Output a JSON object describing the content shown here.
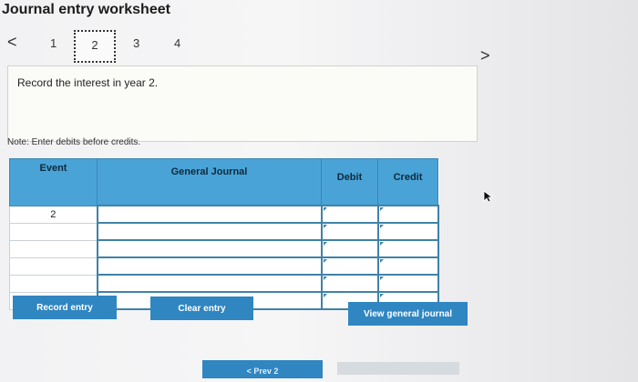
{
  "title": "Journal entry worksheet",
  "nav": {
    "prev": "<",
    "next": ">",
    "steps": [
      "1",
      "2",
      "3",
      "4"
    ],
    "active_step": "2"
  },
  "instruction": "Record the interest in year 2.",
  "note": "Note: Enter debits before credits.",
  "table": {
    "columns": [
      "Event",
      "General Journal",
      "Debit",
      "Credit"
    ],
    "rows": [
      {
        "event": "2",
        "account": "",
        "debit": "",
        "credit": ""
      },
      {
        "event": "",
        "account": "",
        "debit": "",
        "credit": ""
      },
      {
        "event": "",
        "account": "",
        "debit": "",
        "credit": ""
      },
      {
        "event": "",
        "account": "",
        "debit": "",
        "credit": ""
      },
      {
        "event": "",
        "account": "",
        "debit": "",
        "credit": ""
      },
      {
        "event": "",
        "account": "",
        "debit": "",
        "credit": ""
      }
    ]
  },
  "buttons": {
    "record": "Record entry",
    "clear": "Clear entry",
    "view": "View general journal",
    "prev_partial": "< Prev 2"
  },
  "colors": {
    "header_blue": "#4aa3d6",
    "button_blue": "#2f86c1"
  },
  "icons": {
    "cursor": "mouse-pointer-icon"
  }
}
